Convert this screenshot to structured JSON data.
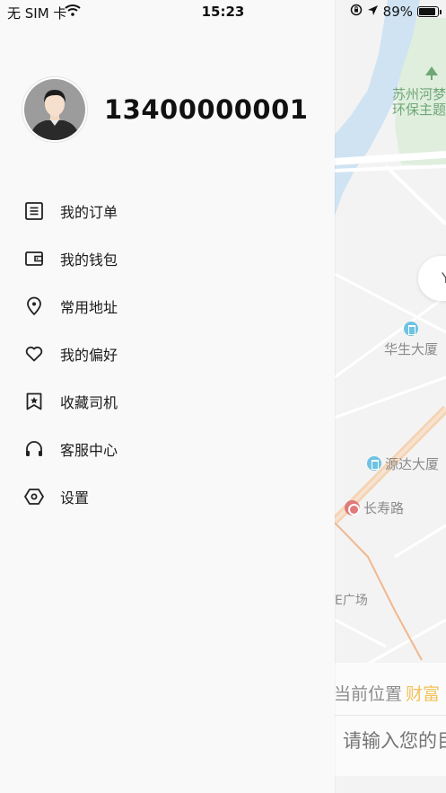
{
  "status_bar": {
    "carrier": "无 SIM 卡",
    "time": "15:23",
    "battery": "89%",
    "battery_level": 0.89
  },
  "profile": {
    "phone": "13400000001"
  },
  "menu": {
    "items": [
      {
        "label": "我的订单",
        "icon": "document-list-icon"
      },
      {
        "label": "我的钱包",
        "icon": "wallet-icon"
      },
      {
        "label": "常用地址",
        "icon": "location-pin-icon"
      },
      {
        "label": "我的偏好",
        "icon": "heart-icon"
      },
      {
        "label": "收藏司机",
        "icon": "bookmark-star-icon"
      },
      {
        "label": "客服中心",
        "icon": "headphones-icon"
      },
      {
        "label": "设置",
        "icon": "settings-hexagon-icon"
      }
    ]
  },
  "map": {
    "labels": {
      "park_line1": "苏州河梦",
      "park_line2": "环保主题",
      "huasheng": "华生大厦",
      "yuanda": "源达大厦",
      "changshou": "长寿路",
      "plaza": "E广场"
    },
    "side_button": "Y"
  },
  "bottom_card": {
    "current_location": "当前位置",
    "location_name": "财富",
    "destination_placeholder": "请输入您的目"
  },
  "colors": {
    "drawer_bg": "#f9f9f9",
    "map_bg": "#f3f3f3",
    "water": "#cfe3f3",
    "park": "#dfeedd",
    "road_orange": "#f5c89a",
    "accent_gold": "#f2c25a"
  }
}
